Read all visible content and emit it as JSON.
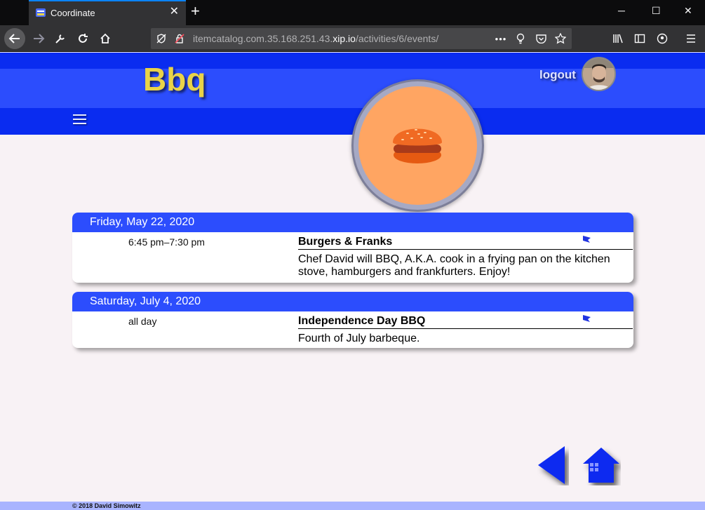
{
  "browser": {
    "tab_title": "Coordinate",
    "url_host": "itemcatalog.com.35.168.251.43.",
    "url_domain": "xip.io",
    "url_path": "/activities/6/events/",
    "url_more": "•••"
  },
  "header": {
    "title": "Bbq",
    "logout_label": "logout"
  },
  "events": [
    {
      "date": "Friday, May 22, 2020",
      "time": "6:45 pm–7:30 pm",
      "name": "Burgers & Franks",
      "description": "Chef David will BBQ, A.K.A. cook in a frying pan on the kitchen stove, hamburgers and frankfurters. Enjoy!"
    },
    {
      "date": "Saturday, July 4, 2020",
      "time": "all day",
      "name": "Independence Day BBQ",
      "description": "Fourth of July barbeque."
    }
  ],
  "footer": {
    "copyright": "© 2018 David Simowitz"
  },
  "icons": {
    "activity": "hamburger-icon",
    "flag": "flag-icon",
    "back": "back-arrow-icon",
    "home": "home-icon",
    "menu": "menu-icon"
  },
  "colors": {
    "header_dark": "#0a2cf0",
    "header_light": "#2c4dfd",
    "title": "#e9d348",
    "activity_bg": "#ffa562",
    "page_bg": "#f8f2f5",
    "footer": "#a9b4ff"
  }
}
